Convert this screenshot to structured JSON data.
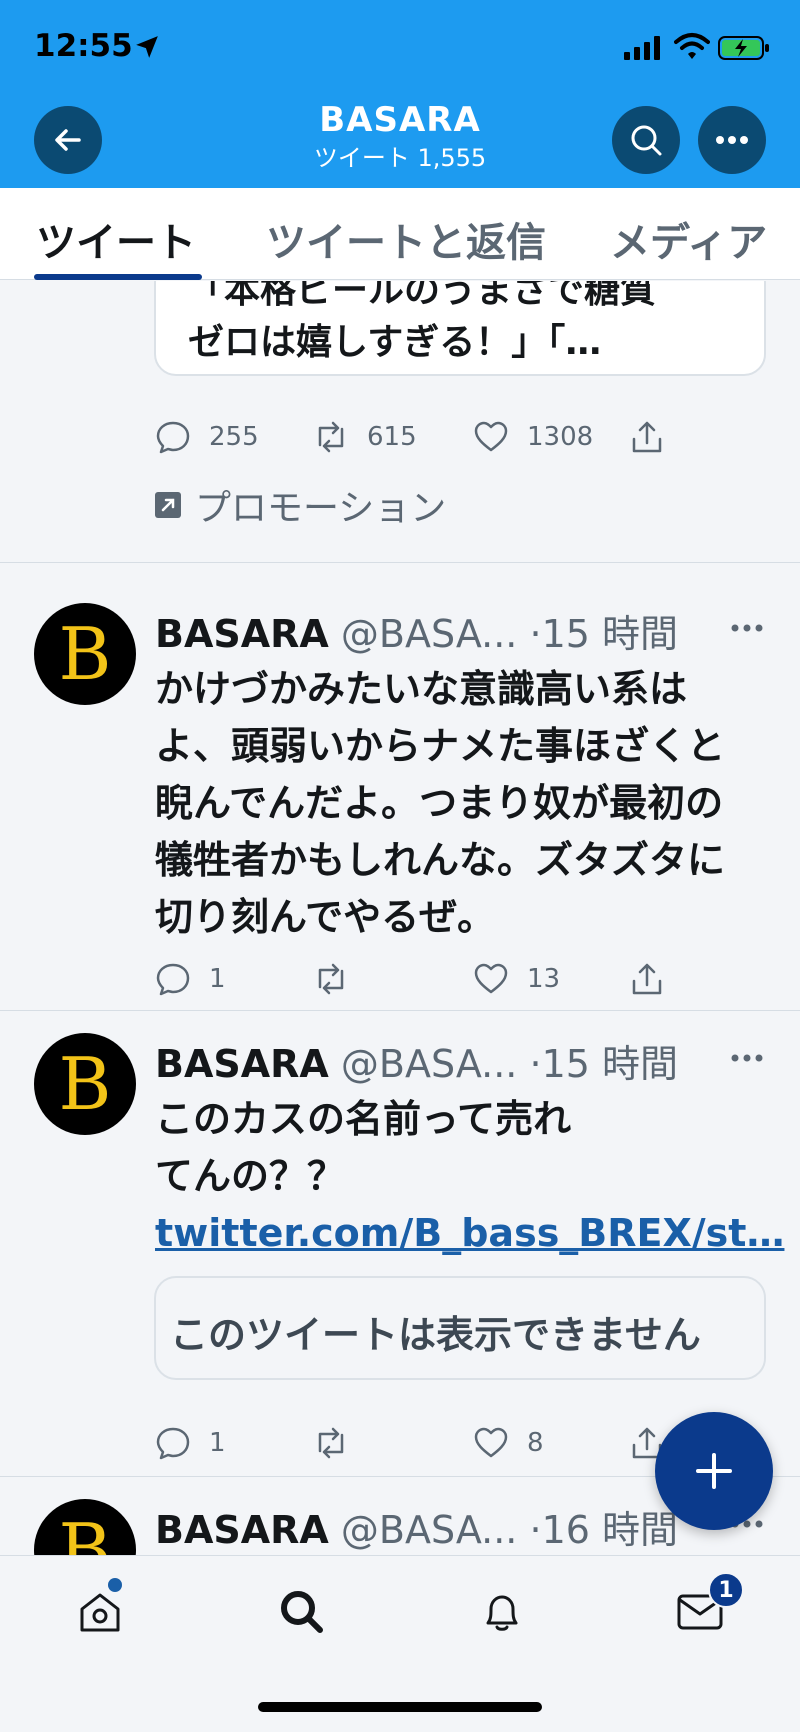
{
  "status_bar": {
    "time": "12:55"
  },
  "header": {
    "name": "BASARA",
    "tweet_count": "ツイート 1,555"
  },
  "tabs": [
    {
      "label": "ツイート",
      "active": true
    },
    {
      "label": "ツイートと返信",
      "active": false
    },
    {
      "label": "メディア",
      "active": false
    }
  ],
  "tweets": [
    {
      "quote_lines": [
        "「本格ビールのうまさで糖質",
        "ゼロは嬉しすぎる！」「…"
      ],
      "actions": {
        "reply": "255",
        "retweet": "615",
        "like": "1308"
      },
      "promo_label": "プロモーション"
    },
    {
      "avatar_letter": "B",
      "name": "BASARA",
      "handle": "@BASA...",
      "dot": "·",
      "time": "15 時間",
      "text": "かけづかみたいな意識高い系はよ、頭弱いからナメた事ほざくと睨んでんだよ。つまり奴が最初の犠牲者かもしれんな。ズタズタに切り刻んでやるぜ。",
      "actions": {
        "reply": "1",
        "retweet": "",
        "like": "13"
      }
    },
    {
      "avatar_letter": "B",
      "name": "BASARA",
      "handle": "@BASA...",
      "dot": "·",
      "time": "15 時間",
      "text": "このカスの名前って売れてんの？？ ",
      "link": "twitter.com/B_bass_BREX/st…",
      "unavailable": "このツイートは表示できません",
      "actions": {
        "reply": "1",
        "retweet": "",
        "like": "8"
      }
    },
    {
      "avatar_letter": "B",
      "name": "BASARA",
      "handle": "@BASA...",
      "dot": "·",
      "time": "16 時間"
    }
  ],
  "bottom_nav": {
    "mail_badge": "1"
  },
  "colors": {
    "header_bg": "#1d9bf0",
    "accent": "#0b3a8c",
    "link": "#1a5fa8",
    "muted": "#5b6773"
  }
}
